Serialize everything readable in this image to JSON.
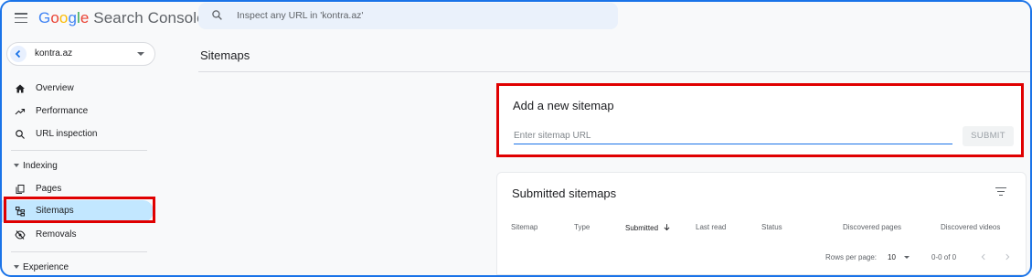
{
  "app": {
    "logo_google": [
      "G",
      "o",
      "o",
      "g",
      "l",
      "e"
    ],
    "logo_product": "Search Console"
  },
  "search": {
    "placeholder": "Inspect any URL in 'kontra.az'"
  },
  "property": {
    "name": "kontra.az"
  },
  "sidebar": {
    "items": [
      {
        "label": "Overview",
        "icon": "home-icon"
      },
      {
        "label": "Performance",
        "icon": "trending-up-icon"
      },
      {
        "label": "URL inspection",
        "icon": "search-icon"
      }
    ],
    "sections": [
      {
        "label": "Indexing",
        "items": [
          {
            "label": "Pages",
            "icon": "pages-icon"
          },
          {
            "label": "Sitemaps",
            "icon": "sitemap-icon",
            "active": true
          },
          {
            "label": "Removals",
            "icon": "removals-icon"
          }
        ]
      },
      {
        "label": "Experience"
      }
    ]
  },
  "main": {
    "title": "Sitemaps",
    "add_sitemap": {
      "title": "Add a new sitemap",
      "input_placeholder": "Enter sitemap URL",
      "submit_label": "SUBMIT"
    },
    "submitted": {
      "title": "Submitted sitemaps",
      "columns": [
        "Sitemap",
        "Type",
        "Submitted",
        "Last read",
        "Status",
        "Discovered pages",
        "Discovered videos"
      ],
      "sorted_column": "Submitted",
      "pagination": {
        "rows_label": "Rows per page:",
        "rows_value": "10",
        "range": "0-0 of 0"
      }
    }
  },
  "colors": {
    "accent": "#1a73e8",
    "active_nav": "#c2e7ff",
    "highlight": "#e00000"
  }
}
